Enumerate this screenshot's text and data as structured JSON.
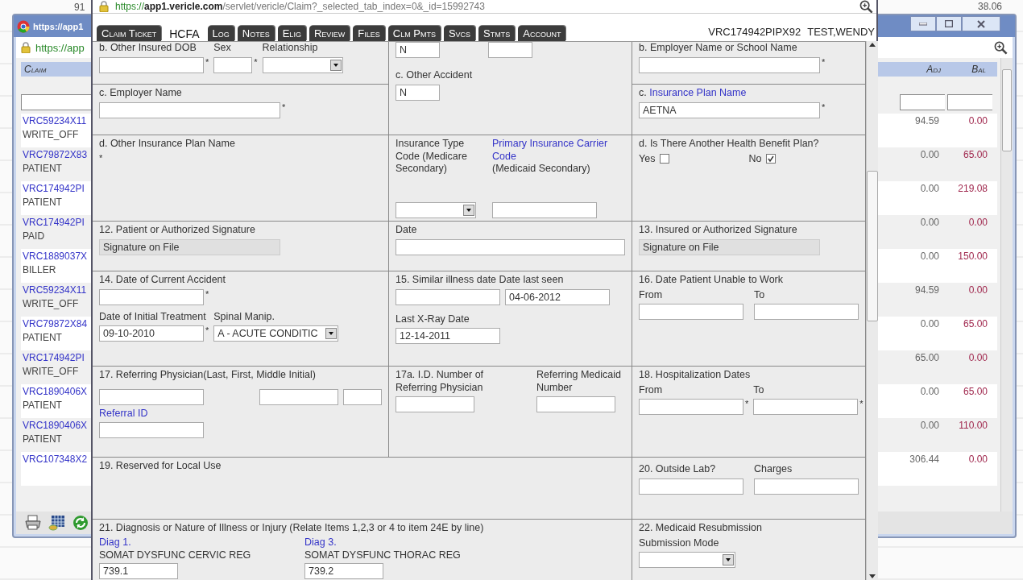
{
  "backdrop": {
    "left_fragment": "91",
    "right_fragment": "38.06"
  },
  "background_window": {
    "title": "https://app1",
    "address": "https://app",
    "columns": [
      "Claim",
      "Adj",
      "Bal"
    ],
    "rows": [
      {
        "claim": "VRC59234X11",
        "payer": "WRITE_OFF",
        "adj": "94.59",
        "bal": "0.00"
      },
      {
        "claim": "VRC79872X83",
        "payer": "PATIENT",
        "adj": "0.00",
        "bal": "65.00"
      },
      {
        "claim": "VRC174942PI",
        "payer": "PATIENT",
        "adj": "0.00",
        "bal": "219.08"
      },
      {
        "claim": "VRC174942PI",
        "payer": "PAID",
        "adj": "0.00",
        "bal": "0.00"
      },
      {
        "claim": "VRC1889037X",
        "payer": "BILLER",
        "adj": "0.00",
        "bal": "150.00"
      },
      {
        "claim": "VRC59234X11",
        "payer": "WRITE_OFF",
        "adj": "94.59",
        "bal": "0.00"
      },
      {
        "claim": "VRC79872X84",
        "payer": "PATIENT",
        "adj": "0.00",
        "bal": "65.00"
      },
      {
        "claim": "VRC174942PI",
        "payer": "WRITE_OFF",
        "adj": "65.00",
        "bal": "0.00"
      },
      {
        "claim": "VRC1890406X",
        "payer": "PATIENT",
        "adj": "0.00",
        "bal": "65.00"
      },
      {
        "claim": "VRC1890406X",
        "payer": "PATIENT",
        "adj": "0.00",
        "bal": "110.00"
      },
      {
        "claim": "VRC107348X2",
        "adj": "306.44",
        "bal": "0.00"
      }
    ]
  },
  "popup": {
    "url_scheme": "https://",
    "url_host": "app1.vericle.com",
    "url_path": "/servlet/vericle/Claim?_selected_tab_index=0&_id=15992743",
    "tabs": [
      {
        "label": "Claim Ticket",
        "selected": false
      },
      {
        "label": "HCFA",
        "selected": true
      },
      {
        "label": "Log",
        "selected": false
      },
      {
        "label": "Notes",
        "selected": false
      },
      {
        "label": "Elig",
        "selected": false
      },
      {
        "label": "Review",
        "selected": false
      },
      {
        "label": "Files",
        "selected": false
      },
      {
        "label": "Clm Pmts",
        "selected": false
      },
      {
        "label": "Svcs",
        "selected": false
      },
      {
        "label": "Stmts",
        "selected": false
      },
      {
        "label": "Account",
        "selected": false
      }
    ],
    "claim_id": "VRC174942PIPX92",
    "patient": "TEST,WENDY"
  },
  "form": {
    "other_insured_dob": {
      "label": "b. Other Insured DOB",
      "mark": "*"
    },
    "sex": {
      "label": "Sex",
      "mark": "*"
    },
    "relationship": {
      "label": "Relationship"
    },
    "accident_field": {
      "value": "N"
    },
    "other_accident": {
      "label": "c. Other Accident",
      "value": "N"
    },
    "employer_school": {
      "label": "b. Employer Name or School Name",
      "mark": "*"
    },
    "employer_name": {
      "label": "c. Employer Name",
      "mark": "*"
    },
    "insurance_plan": {
      "prefix": "c.",
      "link": "Insurance Plan Name",
      "value": "AETNA",
      "mark": "*"
    },
    "other_plan": {
      "label": "d. Other Insurance Plan Name",
      "mark": "*"
    },
    "insurance_type": {
      "label": "Insurance Type Code (Medicare Secondary)"
    },
    "primary_carrier": {
      "link": "Primary Insurance Carrier Code",
      "note": "(Medicaid Secondary)"
    },
    "another_plan": {
      "label": "d. Is There Another Health Benefit Plan?",
      "options": [
        {
          "label": "Yes",
          "checked": false
        },
        {
          "label": "No",
          "checked": true
        }
      ]
    },
    "patient_signature": {
      "label": "12. Patient or Authorized Signature",
      "value": "Signature on File"
    },
    "signature_date": {
      "label": "Date"
    },
    "insured_signature": {
      "label": "13. Insured or Authorized Signature",
      "value": "Signature on File"
    },
    "current_accident": {
      "label": "14. Date of Current Accident",
      "mark": "*"
    },
    "initial_treatment": {
      "label": "Date of Initial Treatment",
      "value": "09-10-2010",
      "mark": "*"
    },
    "spinal_manip": {
      "label": "Spinal Manip.",
      "value": "A - ACUTE CONDITIC"
    },
    "similar_illness": {
      "label": "15. Similar illness date Date last seen",
      "value": "04-06-2012"
    },
    "last_xray": {
      "label": "Last X-Ray Date",
      "value": "12-14-2011"
    },
    "unable_to_work": {
      "label": "16. Date Patient Unable to Work",
      "from": "From",
      "to": "To"
    },
    "referring_physician": {
      "label": "17. Referring Physician(Last, First, Middle Initial)",
      "link": "Referral ID"
    },
    "referring_id": {
      "label": "17a. I.D. Number of Referring Physician"
    },
    "referring_medicaid": {
      "label": "Referring Medicaid Number"
    },
    "hospitalization": {
      "label": "18. Hospitalization Dates",
      "from": "From",
      "to": "To",
      "mark": "*"
    },
    "local_use": {
      "label": "19. Reserved for Local Use"
    },
    "outside_lab": {
      "label": "20. Outside Lab?",
      "charges": "Charges"
    },
    "diagnosis": {
      "label": "21. Diagnosis or Nature of Illness or Injury (Relate Items 1,2,3 or 4 to item 24E by line)",
      "items": [
        {
          "link": "Diag 1.",
          "description": "SOMAT DYSFUNC CERVIC REG",
          "value": "739.1"
        },
        {
          "link": "Diag 3.",
          "description": "SOMAT DYSFUNC THORAC REG",
          "value": "739.2"
        }
      ]
    },
    "medicaid_resubmission": {
      "label": "22. Medicaid Resubmission",
      "mode": "Submission Mode"
    }
  }
}
